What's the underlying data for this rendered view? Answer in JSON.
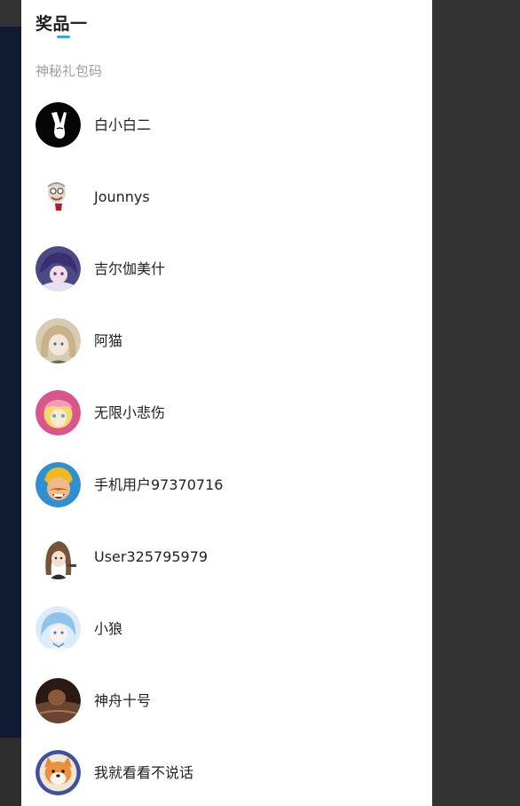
{
  "prize": {
    "title": "奖品一",
    "subtitle": "神秘礼包码"
  },
  "winners": [
    {
      "name": "白小白二",
      "avatar_icon": "peace-hand-avatar"
    },
    {
      "name": "Jounnys",
      "avatar_icon": "cartoon-old-man-avatar"
    },
    {
      "name": "吉尔伽美什",
      "avatar_icon": "anime-purple-hair-avatar"
    },
    {
      "name": "阿猫",
      "avatar_icon": "anime-blonde-girl-avatar"
    },
    {
      "name": "无限小悲伤",
      "avatar_icon": "cartoon-pink-hair-avatar"
    },
    {
      "name": "手机用户97370716",
      "avatar_icon": "clash-barbarian-avatar"
    },
    {
      "name": "User325795979",
      "avatar_icon": "anime-brown-hair-avatar"
    },
    {
      "name": "小狼",
      "avatar_icon": "anime-blue-hair-avatar"
    },
    {
      "name": "神舟十号",
      "avatar_icon": "photo-person-avatar"
    },
    {
      "name": "我就看看不说话",
      "avatar_icon": "shiba-dog-avatar"
    }
  ],
  "colors": {
    "accent": "#1fb5d6",
    "backdrop": "#333333",
    "backdrop_left": "#0f1a33",
    "panel": "#ffffff",
    "subtitle": "#9a9ea6"
  }
}
